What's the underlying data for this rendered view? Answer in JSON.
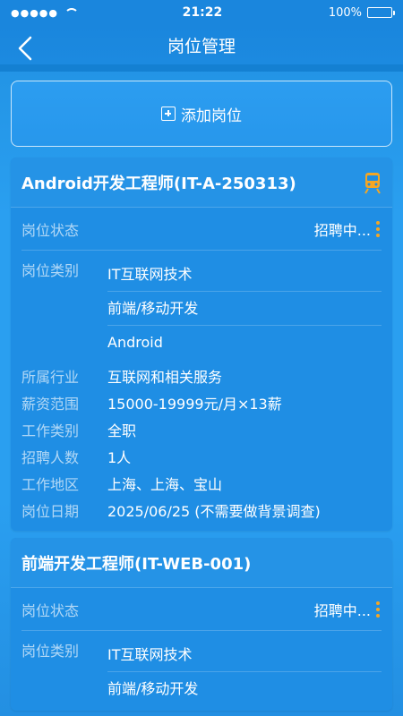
{
  "status_bar": {
    "signal": "●●●●●",
    "time": "21:22",
    "battery": "100%"
  },
  "nav": {
    "title": "岗位管理"
  },
  "add_button": {
    "label": "添加岗位"
  },
  "jobs": [
    {
      "title": "Android开发工程师(IT-A-250313)",
      "status_label": "岗位状态",
      "status": "招聘中...",
      "category_label": "岗位类别",
      "categories": [
        "IT互联网技术",
        "前端/移动开发",
        "Android"
      ],
      "industry_label": "所属行业",
      "industry": "互联网和相关服务",
      "salary_label": "薪资范围",
      "salary": "15000-19999元/月×13薪",
      "type_label": "工作类别",
      "type": "全职",
      "count_label": "招聘人数",
      "count": "1人",
      "location_label": "工作地区",
      "location": "上海、上海、宝山",
      "date_label": "岗位日期",
      "date": "2025/06/25 (不需要做背景调查)"
    },
    {
      "title": "前端开发工程师(IT-WEB-001)",
      "status_label": "岗位状态",
      "status": "招聘中...",
      "category_label": "岗位类别",
      "categories": [
        "IT互联网技术",
        "前端/移动开发"
      ]
    }
  ],
  "colors": {
    "accent_dots": "#f5a623",
    "background": "#2a9ff0"
  }
}
